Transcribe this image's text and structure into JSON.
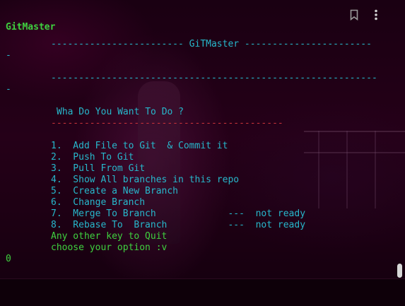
{
  "colors": {
    "green": "#3fd13f",
    "cyan": "#27b8cc",
    "red": "#c8323a",
    "background": "#1a0012"
  },
  "toolbar": {
    "bookmark_icon": "bookmark-icon",
    "menu_icon": "more-vert-icon"
  },
  "terminal": {
    "app_label": "GitMaster",
    "banner_top": "------------------------ GiTMaster -----------------------",
    "wrap_1": "-",
    "banner_bottom": "-----------------------------------------------------------",
    "wrap_2": "-",
    "prompt_title": "Wha Do You Want To Do ?",
    "prompt_rule": "------------------------------------------",
    "menu": [
      {
        "label": "1.  Add File to Git  & Commit it"
      },
      {
        "label": "2.  Push To Git"
      },
      {
        "label": "3.  Pull From Git"
      },
      {
        "label": "4.  Show All branches in this repo"
      },
      {
        "label": "5.  Create a New Branch"
      },
      {
        "label": "6.  Change Branch"
      },
      {
        "label": "7.  Merge To Branch             ---  not ready"
      },
      {
        "label": "8.  Rebase To  Branch           ---  not ready"
      }
    ],
    "quit_hint": "Any other key to Quit",
    "choose_prompt": "choose your option :v",
    "input_value": "0"
  }
}
